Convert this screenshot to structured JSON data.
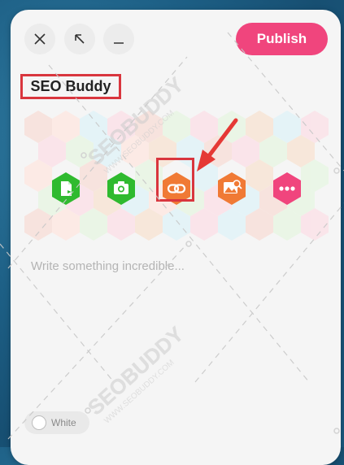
{
  "toolbar": {
    "publish_label": "Publish"
  },
  "post": {
    "title": "SEO Buddy",
    "placeholder": "Write something incredible..."
  },
  "insert_buttons": [
    {
      "name": "file",
      "color": "#2fba2f"
    },
    {
      "name": "camera",
      "color": "#2fba2f"
    },
    {
      "name": "link",
      "color": "#f07a35"
    },
    {
      "name": "image",
      "color": "#f07a35"
    },
    {
      "name": "more",
      "color": "#f0457d"
    }
  ],
  "theme_toggle": {
    "label": "White"
  },
  "watermark": {
    "text": "SEOBUDDY",
    "subtext": "WWW.SEOBUDDY.COM"
  },
  "colors": {
    "accent": "#f0457d",
    "highlight": "#d9363e",
    "panel": "#f5f5f5"
  }
}
